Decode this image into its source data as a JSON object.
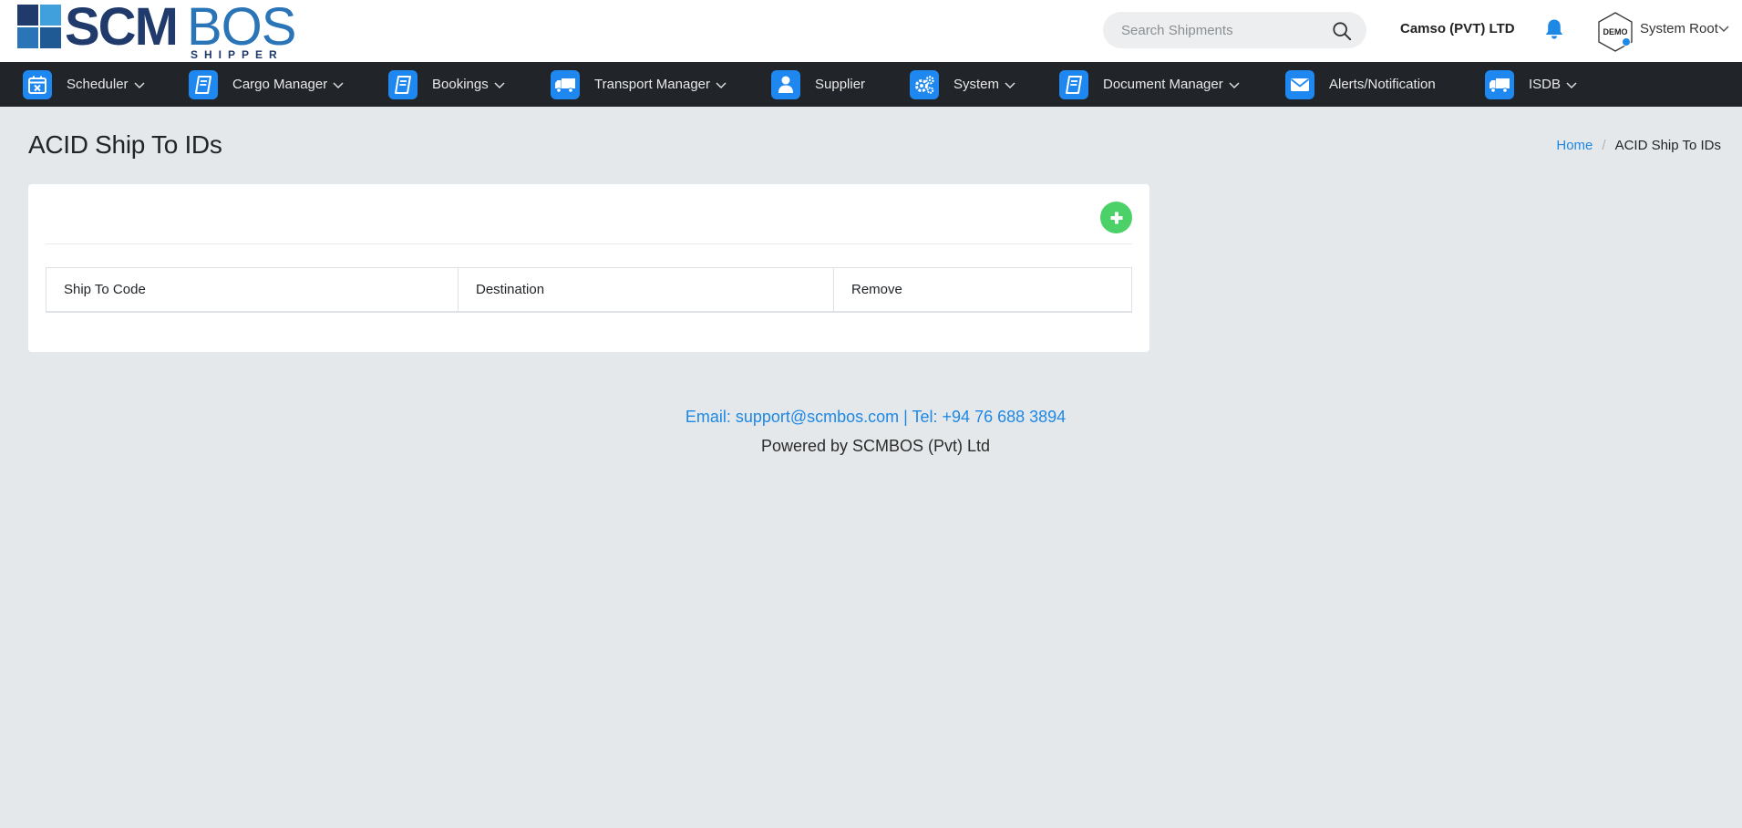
{
  "header": {
    "logo": {
      "primary": "SCM",
      "secondary": "BOS",
      "tagline": "SHIPPER"
    },
    "search": {
      "placeholder": "Search Shipments",
      "value": ""
    },
    "company_name": "Camso (PVT) LTD",
    "user": {
      "name": "System Root",
      "avatar_text": "DEMO"
    }
  },
  "nav": {
    "items": [
      {
        "label": "Scheduler",
        "icon": "calendar-icon",
        "dropdown": true
      },
      {
        "label": "Cargo Manager",
        "icon": "book-icon",
        "dropdown": true
      },
      {
        "label": "Bookings",
        "icon": "book-icon",
        "dropdown": true
      },
      {
        "label": "Transport Manager",
        "icon": "truck-icon",
        "dropdown": true
      },
      {
        "label": "Supplier",
        "icon": "user-icon",
        "dropdown": false
      },
      {
        "label": "System",
        "icon": "gears-icon",
        "dropdown": true
      },
      {
        "label": "Document Manager",
        "icon": "book-icon",
        "dropdown": true
      },
      {
        "label": "Alerts/Notification",
        "icon": "envelope-icon",
        "dropdown": false
      },
      {
        "label": "ISDB",
        "icon": "truck-icon",
        "dropdown": true
      }
    ]
  },
  "page": {
    "title": "ACID Ship To IDs",
    "breadcrumb": {
      "home": "Home",
      "separator": "/",
      "current": "ACID Ship To IDs"
    }
  },
  "table": {
    "columns": [
      "Ship To Code",
      "Destination",
      "Remove"
    ],
    "rows": []
  },
  "footer": {
    "contact": "Email: support@scmbos.com | Tel: +94 76 688 3894",
    "powered_by": "Powered by SCMBOS (Pvt) Ltd"
  },
  "colors": {
    "accent": "#1e88e5",
    "nav_background": "#212529",
    "add_button": "#4cd168",
    "page_background": "#e4e8ea"
  }
}
